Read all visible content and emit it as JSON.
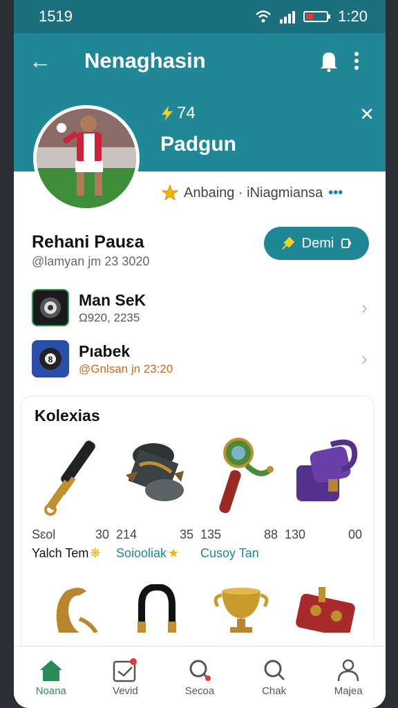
{
  "status": {
    "time_left": "1519",
    "time_right": "1:20"
  },
  "appbar": {
    "title": "Nenaghasin"
  },
  "banner": {
    "score": "74",
    "name": "Padgun"
  },
  "rank": {
    "text": "Anbaing · iNiagmiansa",
    "more": "•••"
  },
  "profile": {
    "name": "Rehani Pauɛa",
    "handle": "@lamyan jm 23 3020",
    "action_label": "Demi"
  },
  "games": [
    {
      "title": "Man SeK",
      "subtitle": "Ω920, 2235"
    },
    {
      "title": "Pıabek",
      "subtitle": "@Gnlsan jn 23:20"
    }
  ],
  "collection": {
    "title": "Kolexias",
    "items": [
      {
        "n1": "Sɛol",
        "n2": "30",
        "name": "Yalch Tem"
      },
      {
        "n1": "214",
        "n2": "35",
        "name": "Soiooliak"
      },
      {
        "n1": "135",
        "n2": "88",
        "name": "Cusoy Tan"
      },
      {
        "n1": "130",
        "n2": "00",
        "name": ""
      }
    ]
  },
  "nav": [
    "Noana",
    "Vevid",
    "Secoa",
    "Chak",
    "Majea"
  ],
  "colors": {
    "accent": "#1f8796",
    "status_bar": "#1c6f7d",
    "active_nav": "#2a8a5a",
    "badge": "#e53935"
  }
}
